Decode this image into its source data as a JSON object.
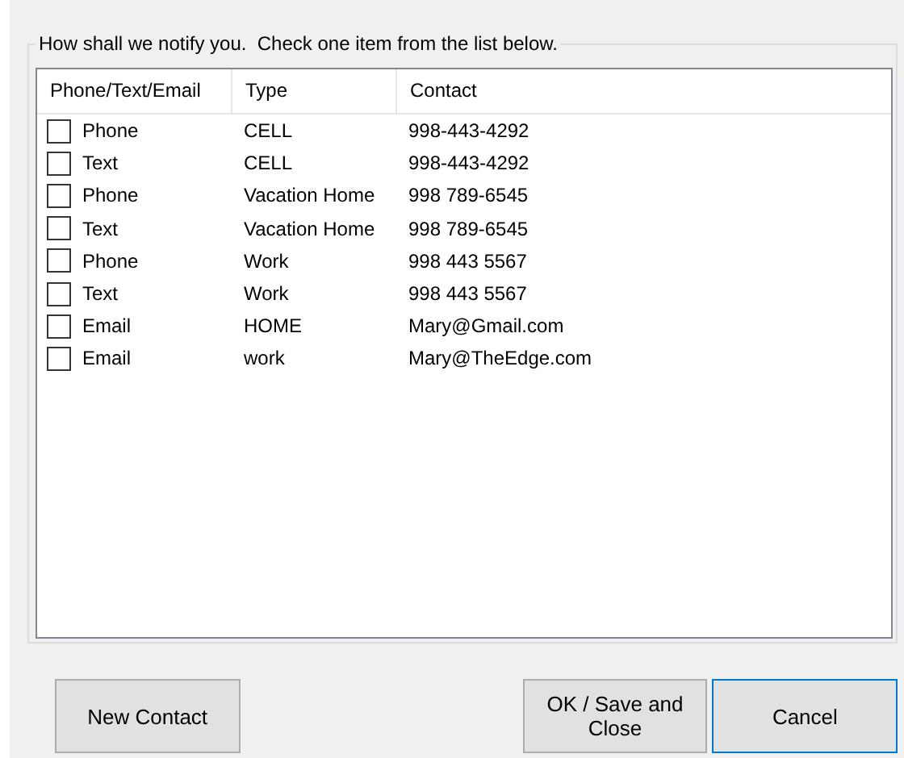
{
  "group_title": "How shall we notify you.  Check one item from the list below.",
  "columns": [
    "Phone/Text/Email",
    "Type",
    "Contact"
  ],
  "rows": [
    {
      "method": "Phone",
      "type": "CELL",
      "contact": "998-443-4292",
      "checked": false
    },
    {
      "method": "Text",
      "type": "CELL",
      "contact": "998-443-4292",
      "checked": false
    },
    {
      "method": "Phone",
      "type": "Vacation Home",
      "contact": "998 789-6545",
      "checked": false
    },
    {
      "method": "Text",
      "type": "Vacation Home",
      "contact": "998 789-6545",
      "checked": false
    },
    {
      "method": "Phone",
      "type": "Work",
      "contact": "998 443 5567",
      "checked": false
    },
    {
      "method": "Text",
      "type": "Work",
      "contact": "998 443 5567",
      "checked": false
    },
    {
      "method": "Email",
      "type": "HOME",
      "contact": "Mary@Gmail.com",
      "checked": false
    },
    {
      "method": "Email",
      "type": "work",
      "contact": "Mary@TheEdge.com",
      "checked": false
    }
  ],
  "buttons": [
    {
      "label": "New Contact",
      "default": false
    },
    {
      "label": "OK / Save and Close",
      "default": false
    },
    {
      "label": "Cancel",
      "default": true
    }
  ]
}
